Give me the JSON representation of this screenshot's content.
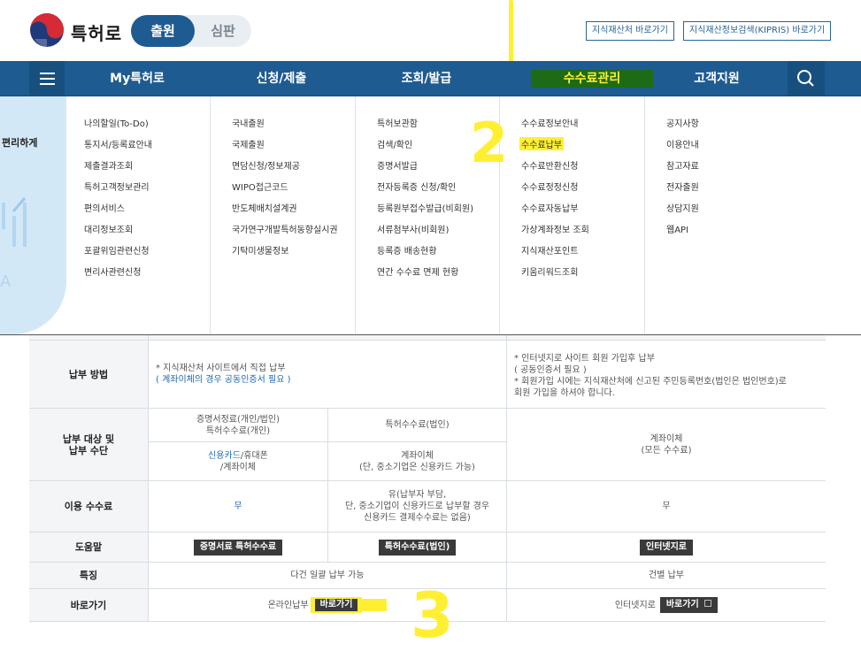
{
  "header": {
    "logo_text": "특허로",
    "toggle": {
      "active": "출원",
      "inactive": "심판"
    },
    "links": [
      "지식재산처 바로가기",
      "지식재산정보검색(KIPRIS) 바로가기"
    ]
  },
  "gnb": {
    "items": [
      "My특허로",
      "신청/제출",
      "조회/발급",
      "수수료관리",
      "고객지원"
    ],
    "active_index": 3
  },
  "mega": {
    "left_text": "편리하게",
    "columns": [
      [
        "나의할일(To-Do)",
        "통지서/등록료안내",
        "제출결과조회",
        "특허고객정보관리",
        "편의서비스",
        "대리정보조회",
        "포괄위임관련신청",
        "변리사관련신청"
      ],
      [
        "국내출원",
        "국제출원",
        "면담신청/정보제공",
        "WIPO접근코드",
        "반도체배치설계권",
        "국가연구개발특허동향실시권",
        "기탁미생물정보"
      ],
      [
        "특허보관함",
        "검색/확인",
        "증명서발급",
        "전자등록증 신청/확인",
        "등록원부접수발급(비회원)",
        "서류첨부사(비회원)",
        "등록증 배송현황",
        "연간 수수료 면제 현황"
      ],
      [
        "수수료정보안내",
        "수수료납부",
        "수수료반환신청",
        "수수료정정신청",
        "수수료자동납부",
        "가상계좌정보 조회",
        "지식재산포인트",
        "키움리워드조회"
      ],
      [
        "공지사항",
        "이용안내",
        "참고자료",
        "전자출원",
        "상담지원",
        "웹API"
      ]
    ]
  },
  "table": {
    "rows": {
      "method": {
        "label": "납부 방법",
        "col1_line1": "* 지식재산처 사이트에서 직접 납부",
        "col1_line2": "( 계좌이체의 경우 공동인증서 필요 )",
        "col2_line1": "* 인터넷지로 사이트 회원 가입후 납부",
        "col2_line2": "( 공동인증서 필요 )",
        "col2_line3": "* 회원가입 시에는 지식재산처에 신고된 주민등록번호(법인은 법인번호)로",
        "col2_line4": "회원 가입을 하셔야 합니다."
      },
      "target": {
        "label_line1": "납부 대상 및",
        "label_line2": "납부 수단",
        "a_top_line1": "증명서정료(개인/법인)",
        "a_top_line2": "특허수수료(개인)",
        "b_top": "특허수수료(법인)",
        "a_bottom_blue": "신용카드",
        "a_bottom_rest": "/휴대폰",
        "a_bottom_line2": "/계좌이체",
        "b_bottom_line1": "계좌이체",
        "b_bottom_line2": "(단, 중소기업은 신용카드 가능)",
        "c_line1": "계좌이체",
        "c_line2": "(모든 수수료)"
      },
      "fee": {
        "label": "이용 수수료",
        "a": "무",
        "b_line1": "유(납부자 부담,",
        "b_line2": "단, 중소기업이 신용카드로 납부할 경우",
        "b_line3": "신용카드 결제수수료는 없음)",
        "c": "무"
      },
      "help": {
        "label": "도움말",
        "a": "증명서료 특허수수료",
        "b": "특허수수료(법인)",
        "c": "인터넷지로"
      },
      "feature": {
        "label": "특징",
        "ab": "다건 일괄 납부 가능",
        "c": "건별 납부"
      },
      "shortcut": {
        "label": "바로가기",
        "ab_text": "온라인납부",
        "ab_btn": "바로가기",
        "c_text": "인터넷지로",
        "c_btn": "바로가기"
      }
    }
  },
  "annotations": {
    "two": "2",
    "three": "3"
  },
  "colors": {
    "brand": "#1e5b91",
    "highlight": "#ffef33",
    "active_bg": "#1d6b16"
  }
}
